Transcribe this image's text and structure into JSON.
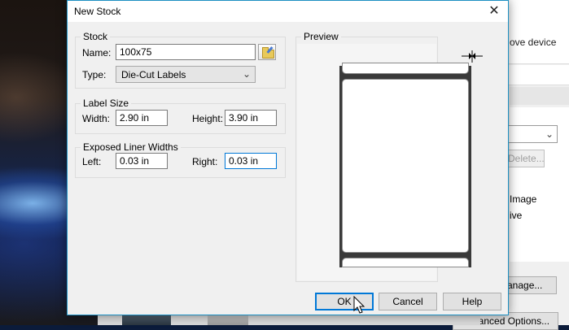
{
  "background_window": {
    "header_text": "ove device",
    "delete_label": "Delete...",
    "option_image": "Image",
    "option_ive": "ive",
    "manage_label": "anage...",
    "advanced_options_label": "Advanced Options..."
  },
  "dialog": {
    "title": "New Stock",
    "stock": {
      "group_label": "Stock",
      "name_label": "Name:",
      "name_value": "100x75",
      "type_label": "Type:",
      "type_value": "Die-Cut Labels"
    },
    "label_size": {
      "group_label": "Label Size",
      "width_label": "Width:",
      "width_value": "2.90 in",
      "height_label": "Height:",
      "height_value": "3.90 in"
    },
    "liner": {
      "group_label": "Exposed Liner Widths",
      "left_label": "Left:",
      "left_value": "0.03 in",
      "right_label": "Right:",
      "right_value": "0.03 in"
    },
    "preview": {
      "group_label": "Preview"
    },
    "buttons": {
      "ok": "OK",
      "cancel": "Cancel",
      "help": "Help"
    }
  },
  "colors": {
    "accent": "#0078d7",
    "title_border": "#1b8fc2",
    "liner": "#3a3a3a"
  }
}
